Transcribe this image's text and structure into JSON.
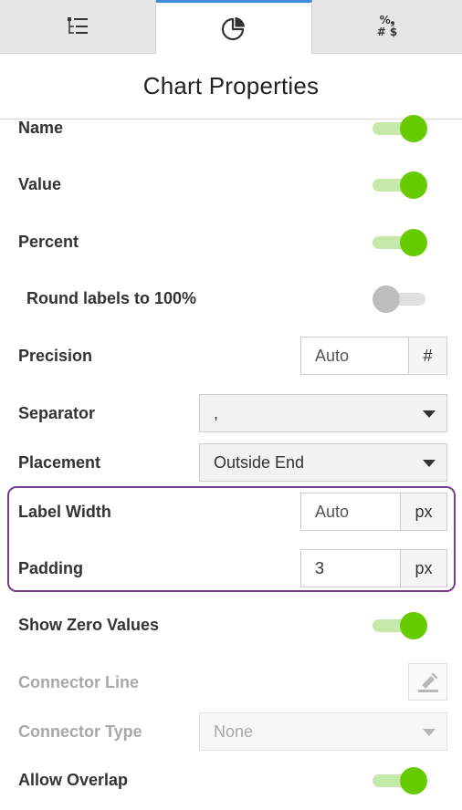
{
  "tabs": [
    {
      "icon": "list-tree-icon",
      "active": false
    },
    {
      "icon": "pie-chart-icon",
      "active": true
    },
    {
      "icon": "number-format-icon",
      "active": false,
      "glyph_line1": "%❟",
      "glyph_line2": "# $"
    }
  ],
  "panel": {
    "title": "Chart Properties"
  },
  "settings": {
    "name": {
      "label": "Name",
      "on": true
    },
    "value": {
      "label": "Value",
      "on": true
    },
    "percent": {
      "label": "Percent",
      "on": true
    },
    "round_labels": {
      "label": "Round labels to 100%",
      "on": false
    },
    "precision": {
      "label": "Precision",
      "placeholder": "Auto",
      "addon": "#"
    },
    "separator": {
      "label": "Separator",
      "selected": ","
    },
    "placement": {
      "label": "Placement",
      "selected": "Outside End"
    },
    "label_width": {
      "label": "Label Width",
      "placeholder": "Auto",
      "unit": "px"
    },
    "padding": {
      "label": "Padding",
      "value": "3",
      "unit": "px"
    },
    "show_zero": {
      "label": "Show Zero Values",
      "on": true
    },
    "connector_line": {
      "label": "Connector Line",
      "icon": "paint-bucket-icon",
      "disabled": true
    },
    "connector_type": {
      "label": "Connector Type",
      "selected": "None",
      "disabled": true
    },
    "allow_overlap": {
      "label": "Allow Overlap",
      "on": true
    }
  },
  "colors": {
    "accent": "#66cc00",
    "highlight": "#7a3b8c",
    "tab_active_border": "#3c8ddb"
  }
}
